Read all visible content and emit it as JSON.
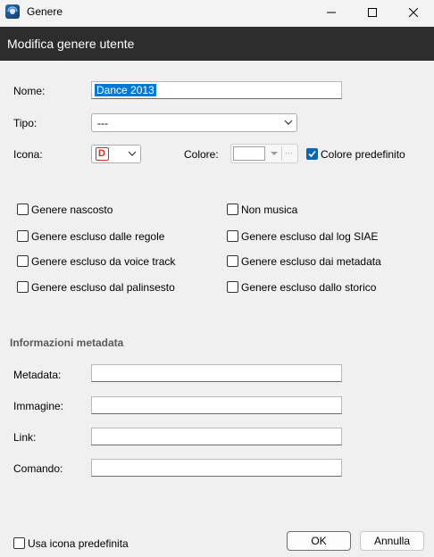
{
  "window": {
    "title": "Genere",
    "minimize_icon": "minimize-icon",
    "maximize_icon": "maximize-icon",
    "close_icon": "close-icon"
  },
  "header": {
    "title": "Modifica genere utente"
  },
  "form": {
    "name_label": "Nome:",
    "name_value": "Dance 2013",
    "type_label": "Tipo:",
    "type_value": "---",
    "icon_label": "Icona:",
    "icon_value": "D",
    "color_label": "Colore:",
    "default_color_label": "Colore predefinito",
    "default_color_checked": true,
    "color_swatch": "#ffffff"
  },
  "options": {
    "left": [
      {
        "label": "Genere nascosto",
        "checked": false
      },
      {
        "label": "Genere escluso dalle regole",
        "checked": false
      },
      {
        "label": "Genere escluso da voice track",
        "checked": false
      },
      {
        "label": "Genere escluso dal palinsesto",
        "checked": false
      }
    ],
    "right": [
      {
        "label": "Non musica",
        "checked": false
      },
      {
        "label": "Genere escluso dal log SIAE",
        "checked": false
      },
      {
        "label": "Genere escluso dai metadata",
        "checked": false
      },
      {
        "label": "Genere escluso dallo storico",
        "checked": false
      }
    ]
  },
  "metadata": {
    "section_title": "Informazioni metadata",
    "metadata_label": "Metadata:",
    "image_label": "Immagine:",
    "link_label": "Link:",
    "command_label": "Comando:",
    "metadata_value": "",
    "image_value": "",
    "link_value": "",
    "command_value": ""
  },
  "footer": {
    "default_icon_label": "Usa icona predefinita",
    "default_icon_checked": false,
    "ok_label": "OK",
    "cancel_label": "Annulla"
  },
  "colors": {
    "accent": "#0067c0",
    "header_bg": "#2d2d2d",
    "icon_red": "#d9261c"
  }
}
